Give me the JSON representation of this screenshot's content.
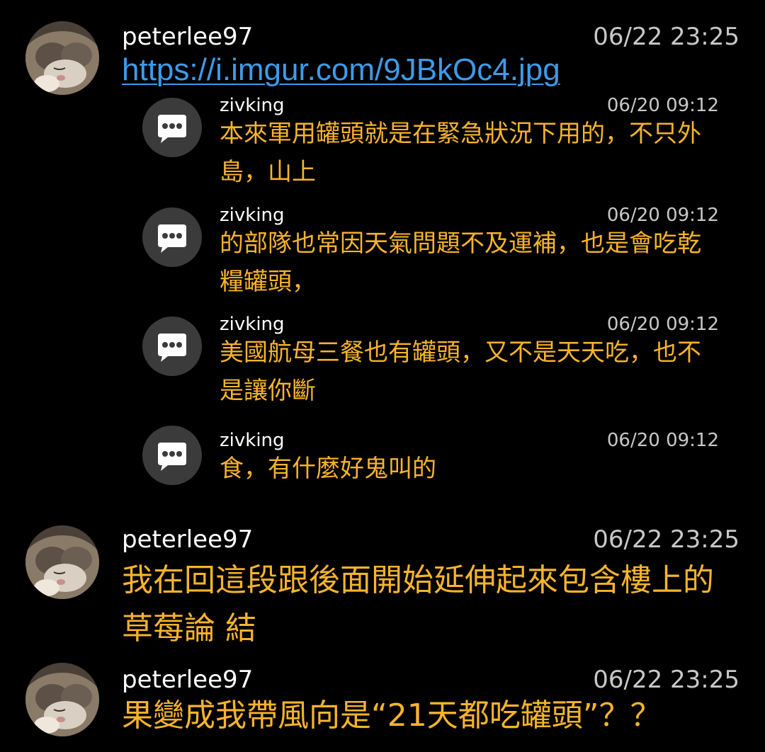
{
  "posts": [
    {
      "author": "peterlee97",
      "time": "06/22 23:25",
      "link": "https://i.imgur.com/9JBkOc4.jpg"
    },
    {
      "author": "peterlee97",
      "time": "06/22 23:25",
      "text": "我在回這段跟後面開始延伸起來包含樓上的草莓論 結"
    },
    {
      "author": "peterlee97",
      "time": "06/22 23:25",
      "text": "果變成我帶風向是“21天都吃罐頭”？？"
    }
  ],
  "replies": [
    {
      "icon": "chat-bubble-icon",
      "author": "zivking",
      "time": "06/20 09:12",
      "text": "本來軍用罐頭就是在緊急狀況下用的，不只外島，山上"
    },
    {
      "icon": "chat-bubble-icon",
      "author": "zivking",
      "time": "06/20 09:12",
      "text": "的部隊也常因天氣問題不及運補，也是會吃乾糧罐頭，"
    },
    {
      "icon": "chat-bubble-icon",
      "author": "zivking",
      "time": "06/20 09:12",
      "text": "美國航母三餐也有罐頭，又不是天天吃，也不是讓你斷"
    },
    {
      "icon": "chat-bubble-icon",
      "author": "zivking",
      "time": "06/20 09:12",
      "text": "食，有什麼好鬼叫的"
    }
  ],
  "colors": {
    "background": "#000000",
    "comment_text": "#f7b42c",
    "link": "#3d9be9",
    "timestamp": "#c8c8c8",
    "icon_circle": "#3b3b3b"
  }
}
